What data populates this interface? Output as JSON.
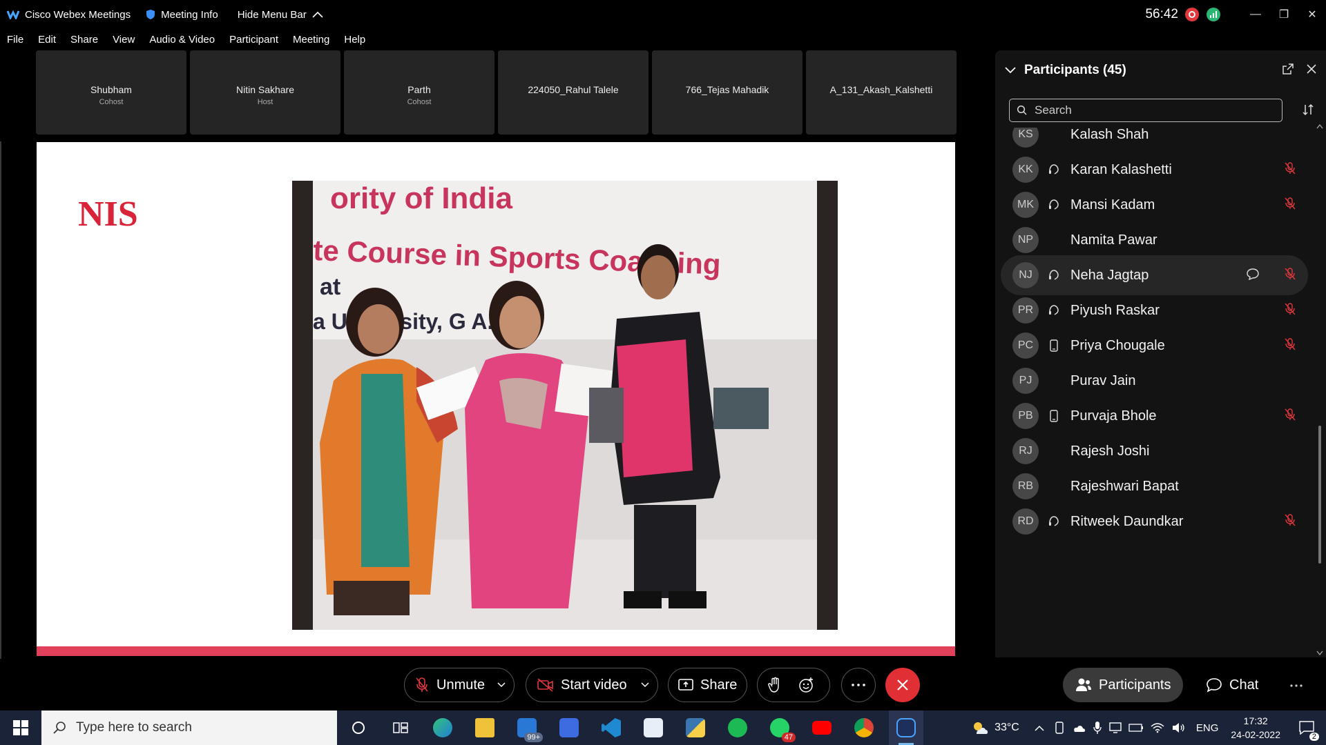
{
  "titlebar": {
    "app_title": "Cisco Webex Meetings",
    "meeting_info": "Meeting Info",
    "hide_menu": "Hide Menu Bar",
    "timer": "56:42"
  },
  "menu": [
    "File",
    "Edit",
    "Share",
    "View",
    "Audio & Video",
    "Participant",
    "Meeting",
    "Help"
  ],
  "video_tiles": [
    {
      "name": "Shubham",
      "role": "Cohost"
    },
    {
      "name": "Nitin Sakhare",
      "role": "Host"
    },
    {
      "name": "Parth",
      "role": "Cohost"
    },
    {
      "name": "224050_Rahul Talele",
      "role": ""
    },
    {
      "name": "766_Tejas Mahadik",
      "role": ""
    },
    {
      "name": "A_131_Akash_Kalshetti",
      "role": ""
    }
  ],
  "slide": {
    "logo_text": "NIS",
    "banner_line1": "ority of India",
    "banner_line2": "te Course in Sports Coaching",
    "banner_line3": "at",
    "banner_line4": "a University, G      A.P",
    "accent": "#e0405a"
  },
  "participants_panel": {
    "title": "Participants (45)",
    "search_placeholder": "Search",
    "items": [
      {
        "initials": "KS",
        "name": "Kalash Shah",
        "status": "none",
        "muted": false
      },
      {
        "initials": "KK",
        "name": "Karan Kalashetti",
        "status": "computer-audio",
        "muted": true
      },
      {
        "initials": "MK",
        "name": "Mansi Kadam",
        "status": "computer-audio",
        "muted": true
      },
      {
        "initials": "NP",
        "name": "Namita Pawar",
        "status": "none",
        "muted": false
      },
      {
        "initials": "NJ",
        "name": "Neha Jagtap",
        "status": "computer-audio",
        "muted": true,
        "highlight": true
      },
      {
        "initials": "PR",
        "name": "Piyush Raskar",
        "status": "computer-audio",
        "muted": true
      },
      {
        "initials": "PC",
        "name": "Priya Chougale",
        "status": "phone",
        "muted": true
      },
      {
        "initials": "PJ",
        "name": "Purav Jain",
        "status": "none",
        "muted": false
      },
      {
        "initials": "PB",
        "name": "Purvaja Bhole",
        "status": "phone",
        "muted": true
      },
      {
        "initials": "RJ",
        "name": "Rajesh Joshi",
        "status": "none",
        "muted": false
      },
      {
        "initials": "RB",
        "name": "Rajeshwari Bapat",
        "status": "none",
        "muted": false
      },
      {
        "initials": "RD",
        "name": "Ritweek Daundkar",
        "status": "computer-audio",
        "muted": true
      }
    ]
  },
  "controls": {
    "unmute": "Unmute",
    "start_video": "Start video",
    "share": "Share",
    "participants": "Participants",
    "chat": "Chat",
    "end_color": "#e02f35"
  },
  "taskbar": {
    "search_placeholder": "Type here to search",
    "mail_badge": "99+",
    "whatsapp_badge": "47",
    "temperature": "33°C",
    "language": "ENG",
    "time": "17:32",
    "date": "24-02-2022",
    "notif_count": "2"
  }
}
